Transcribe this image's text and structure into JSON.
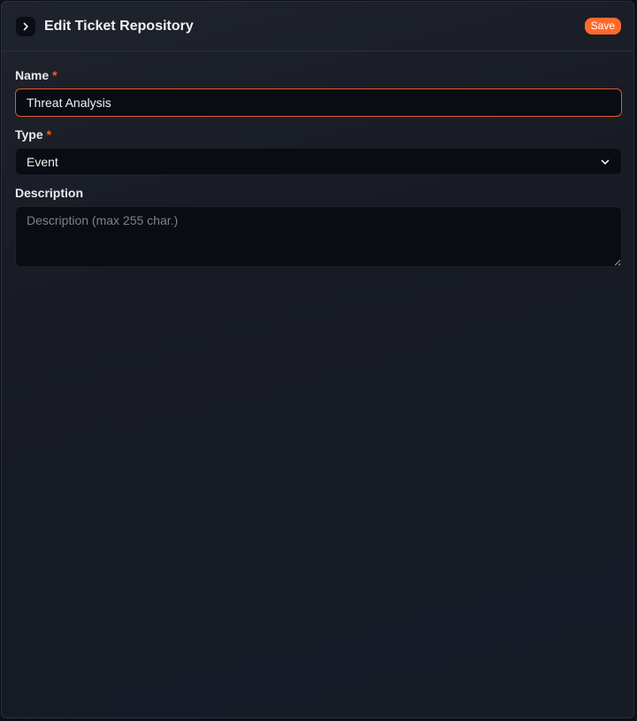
{
  "header": {
    "title": "Edit Ticket Repository",
    "save_label": "Save",
    "collapse_icon": "chevron-right-icon"
  },
  "form": {
    "name": {
      "label": "Name",
      "required_mark": "*",
      "value": "Threat Analysis"
    },
    "type": {
      "label": "Type",
      "required_mark": "*",
      "selected": "Event",
      "dropdown_icon": "chevron-down-icon"
    },
    "description": {
      "label": "Description",
      "placeholder": "Description (max 255 char.)",
      "value": ""
    }
  },
  "colors": {
    "accent": "#ff6a2b",
    "required": "#ff5a2a",
    "panel_bg": "#181b24",
    "field_bg": "#090c13"
  }
}
